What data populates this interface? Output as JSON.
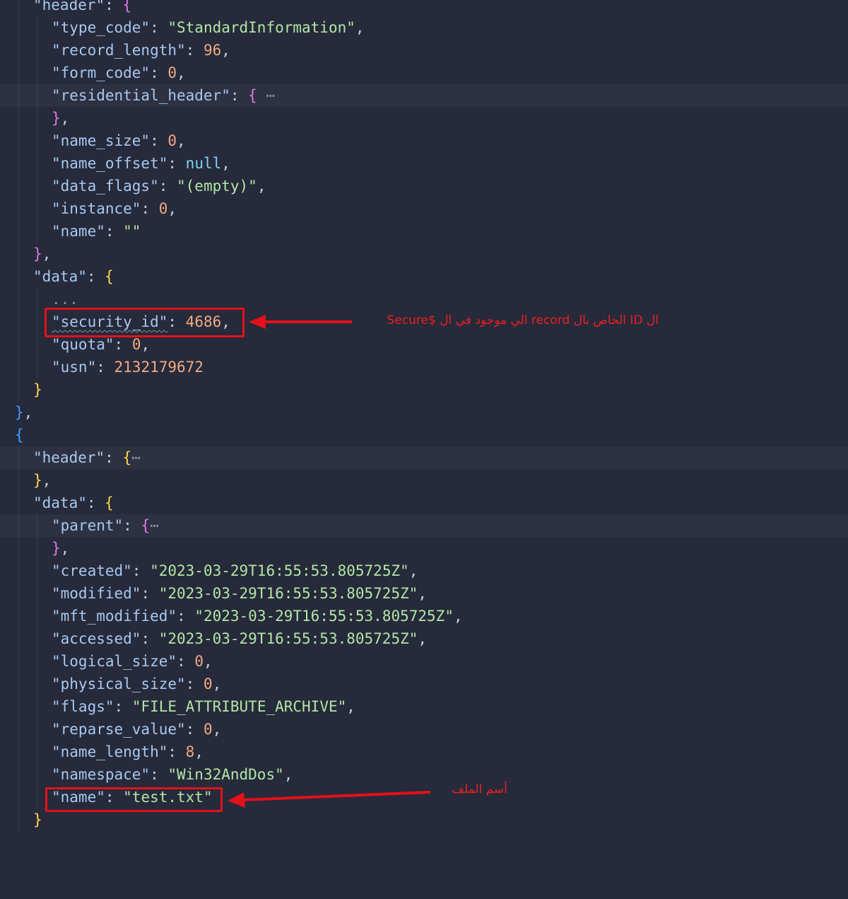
{
  "colors": {
    "background": "#262a3a",
    "annotation": "#e3111b"
  },
  "code": {
    "l1_key": "\"header\"",
    "l2_key": "\"type_code\"",
    "l2_val": "\"StandardInformation\"",
    "l3_key": "\"record_length\"",
    "l3_val": "96",
    "l4_key": "\"form_code\"",
    "l4_val": "0",
    "l5_key": "\"residential_header\"",
    "l7_key": "\"name_size\"",
    "l7_val": "0",
    "l8_key": "\"name_offset\"",
    "l8_val": "null",
    "l9_key": "\"data_flags\"",
    "l9_val": "\"(empty)\"",
    "l10_key": "\"instance\"",
    "l10_val": "0",
    "l11_key": "\"name\"",
    "l11_val": "\"\"",
    "l13_key": "\"data\"",
    "l14_text": "...",
    "l15_key": "\"security_id\"",
    "l15_val": "4686",
    "l16_key": "\"quota\"",
    "l16_val": "0",
    "l17_key": "\"usn\"",
    "l17_val": "2132179672",
    "l21_key": "\"header\"",
    "l23_key": "\"data\"",
    "l24_key": "\"parent\"",
    "l26_key": "\"created\"",
    "l26_val": "\"2023-03-29T16:55:53.805725Z\"",
    "l27_key": "\"modified\"",
    "l27_val": "\"2023-03-29T16:55:53.805725Z\"",
    "l28_key": "\"mft_modified\"",
    "l28_val": "\"2023-03-29T16:55:53.805725Z\"",
    "l29_key": "\"accessed\"",
    "l29_val": "\"2023-03-29T16:55:53.805725Z\"",
    "l30_key": "\"logical_size\"",
    "l30_val": "0",
    "l31_key": "\"physical_size\"",
    "l31_val": "0",
    "l32_key": "\"flags\"",
    "l32_val": "\"FILE_ATTRIBUTE_ARCHIVE\"",
    "l33_key": "\"reparse_value\"",
    "l33_val": "0",
    "l34_key": "\"name_length\"",
    "l34_val": "8",
    "l35_key": "\"namespace\"",
    "l35_val": "\"Win32AndDos\"",
    "l36_key": "\"name\"",
    "l36_val": "\"test.txt\""
  },
  "annotations": {
    "security_note": "ال ID الخاص بال record الي موجود في ال $Secure",
    "name_note": "أسم الملف"
  }
}
